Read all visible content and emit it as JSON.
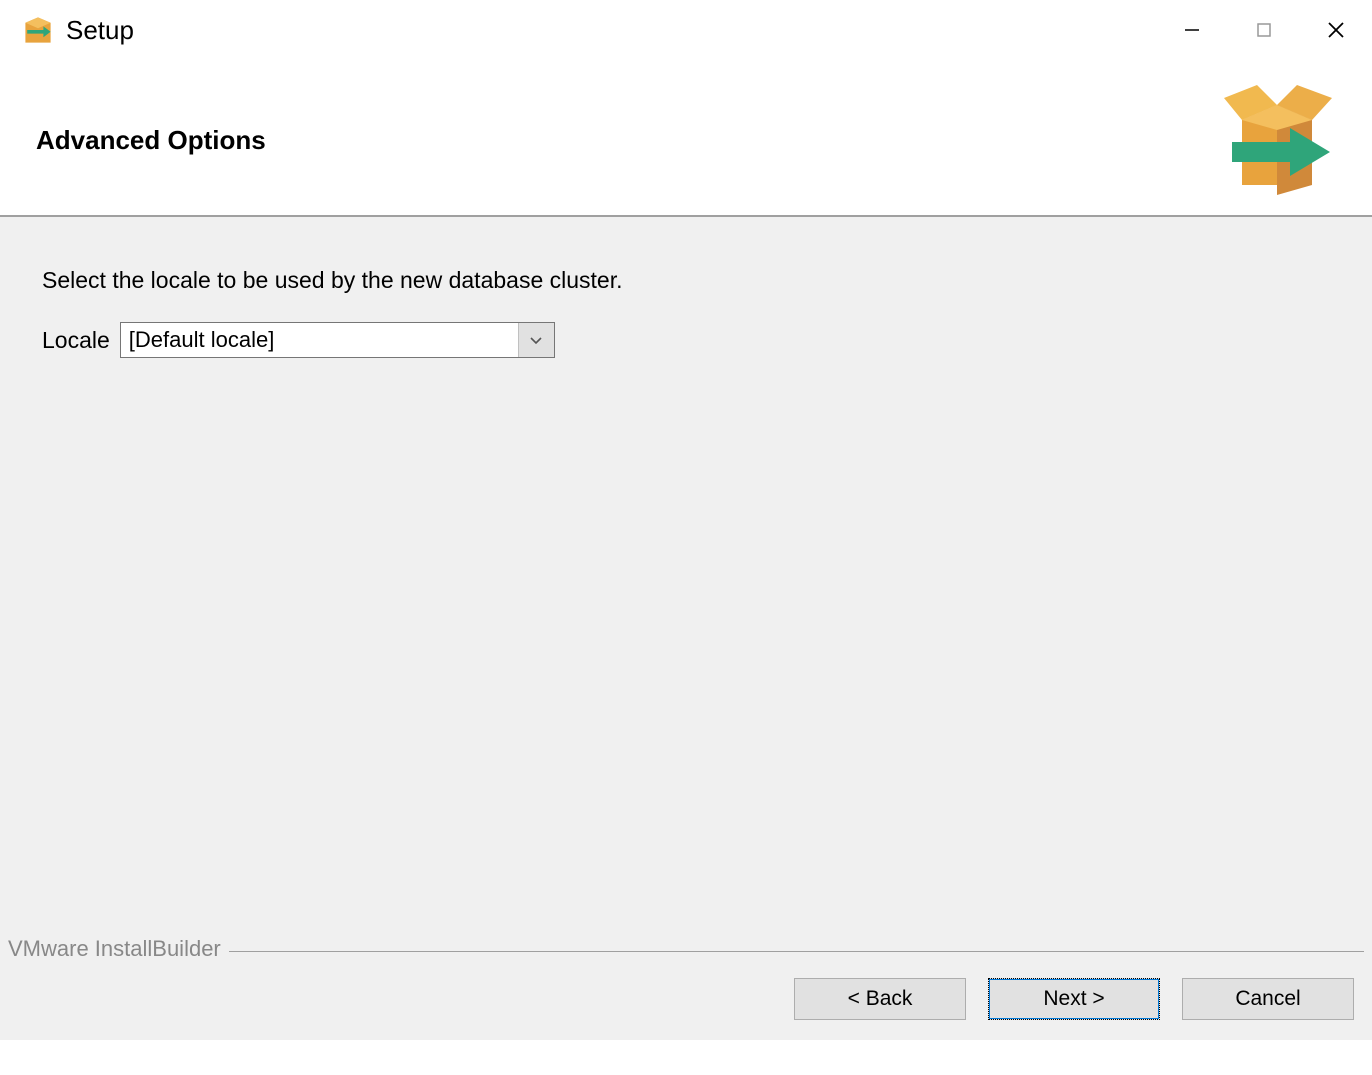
{
  "titlebar": {
    "title": "Setup"
  },
  "header": {
    "title": "Advanced Options"
  },
  "main": {
    "instruction": "Select the locale to be used by the new database cluster.",
    "locale_label": "Locale",
    "locale_value": "[Default locale]"
  },
  "footer": {
    "branding": "VMware InstallBuilder",
    "back_label": "< Back",
    "next_label": "Next >",
    "cancel_label": "Cancel"
  }
}
